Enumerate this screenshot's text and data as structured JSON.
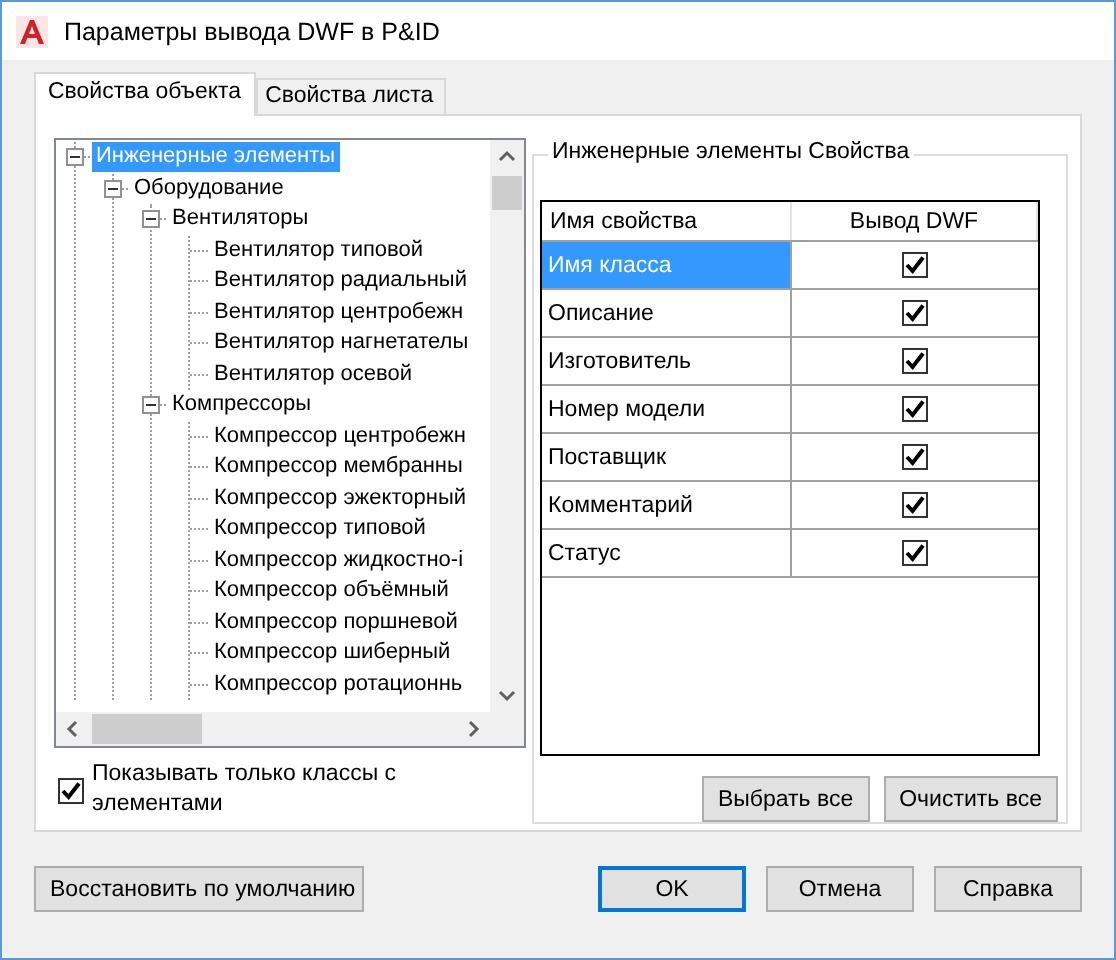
{
  "window": {
    "title": "Параметры вывода DWF в P&ID"
  },
  "tabs": [
    {
      "label": "Свойства объекта",
      "selected": true
    },
    {
      "label": "Свойства листа",
      "selected": false
    }
  ],
  "tree": [
    {
      "label": "Инженерные элементы",
      "selected": true,
      "expanded": true,
      "children": [
        {
          "label": "Оборудование",
          "selected": false,
          "expanded": true,
          "children": [
            {
              "label": "Вентиляторы",
              "selected": false,
              "expanded": true,
              "children": [
                {
                  "label": "Вентилятор типовой",
                  "selected": false
                },
                {
                  "label": "Вентилятор радиальный",
                  "selected": false
                },
                {
                  "label": "Вентилятор центробежн",
                  "selected": false
                },
                {
                  "label": "Вентилятор нагнетателы",
                  "selected": false
                },
                {
                  "label": "Вентилятор осевой",
                  "selected": false
                }
              ]
            },
            {
              "label": "Компрессоры",
              "selected": false,
              "expanded": true,
              "children": [
                {
                  "label": "Компрессор центробежн",
                  "selected": false
                },
                {
                  "label": "Компрессор мембранны",
                  "selected": false
                },
                {
                  "label": "Компрессор эжекторный",
                  "selected": false
                },
                {
                  "label": "Компрессор типовой",
                  "selected": false
                },
                {
                  "label": "Компрессор жидкостно-і",
                  "selected": false
                },
                {
                  "label": "Компрессор объёмный",
                  "selected": false
                },
                {
                  "label": "Компрессор поршневой",
                  "selected": false
                },
                {
                  "label": "Компрессор шиберный",
                  "selected": false
                },
                {
                  "label": "Компрессор ротационнь",
                  "selected": false
                }
              ]
            }
          ]
        }
      ]
    }
  ],
  "show_only_checkbox": {
    "label": "Показывать только классы с элементами",
    "checked": true
  },
  "properties": {
    "title": "Инженерные элементы Свойства",
    "columns": [
      "Имя свойства",
      "Вывод DWF"
    ],
    "rows": [
      {
        "name": "Имя класса",
        "selected": true,
        "dwf_output": true
      },
      {
        "name": "Описание",
        "selected": false,
        "dwf_output": true
      },
      {
        "name": "Изготовитель",
        "selected": false,
        "dwf_output": true
      },
      {
        "name": "Номер модели",
        "selected": false,
        "dwf_output": true
      },
      {
        "name": "Поставщик",
        "selected": false,
        "dwf_output": true
      },
      {
        "name": "Комментарий",
        "selected": false,
        "dwf_output": true
      },
      {
        "name": "Статус",
        "selected": false,
        "dwf_output": true
      }
    ],
    "buttons": [
      "Выбрать все",
      "Очистить все"
    ]
  },
  "restore_button": "Восстановить по умолчанию",
  "dialog_buttons": [
    {
      "label": "OK",
      "default": true
    },
    {
      "label": "Отмена",
      "default": false
    },
    {
      "label": "Справка",
      "default": false
    }
  ]
}
